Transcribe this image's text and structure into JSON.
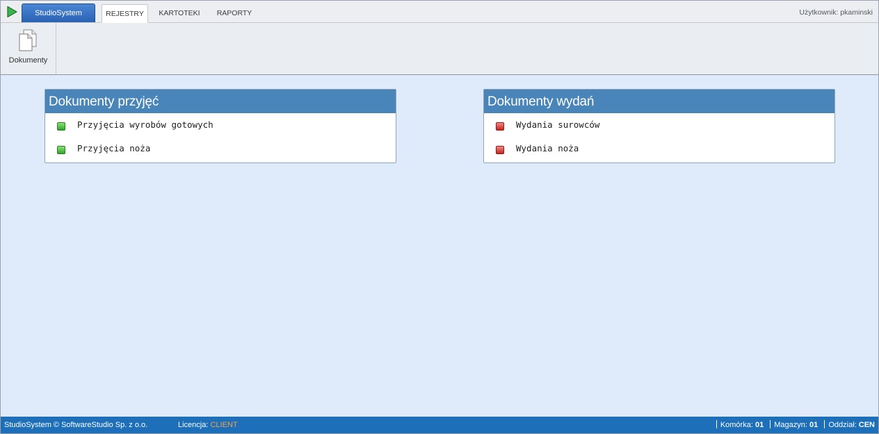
{
  "topbar": {
    "app_button": "StudioSystem",
    "tabs": [
      {
        "label": "REJESTRY",
        "active": true
      },
      {
        "label": "KARTOTEKI",
        "active": false
      },
      {
        "label": "RAPORTY",
        "active": false
      }
    ],
    "user_label": "Użytkownik: pkaminski"
  },
  "ribbon": {
    "items": [
      {
        "label": "Dokumenty",
        "icon": "documents-icon"
      }
    ]
  },
  "panels": {
    "receipts": {
      "title": "Dokumenty przyjęć",
      "items": [
        {
          "label": "Przyjęcia wyrobów gotowych",
          "status": "green"
        },
        {
          "label": "Przyjęcia noża",
          "status": "green"
        }
      ]
    },
    "issues": {
      "title": "Dokumenty wydań",
      "items": [
        {
          "label": "Wydania surowców",
          "status": "red"
        },
        {
          "label": "Wydania noża",
          "status": "red"
        }
      ]
    }
  },
  "statusbar": {
    "copyright": "StudioSystem © SoftwareStudio Sp. z o.o.",
    "licence_label": "Licencja:",
    "licence_value": "CLIENT",
    "cell_label": "Komórka:",
    "cell_value": "01",
    "warehouse_label": "Magazyn:",
    "warehouse_value": "01",
    "branch_label": "Oddział:",
    "branch_value": "CEN"
  },
  "colors": {
    "accent": "#4985b9",
    "statusbar": "#1c6fb8",
    "licence_value": "#f2a24a",
    "background": "#dfebfb",
    "status_green": "#2fa52a",
    "status_red": "#c8231f"
  }
}
